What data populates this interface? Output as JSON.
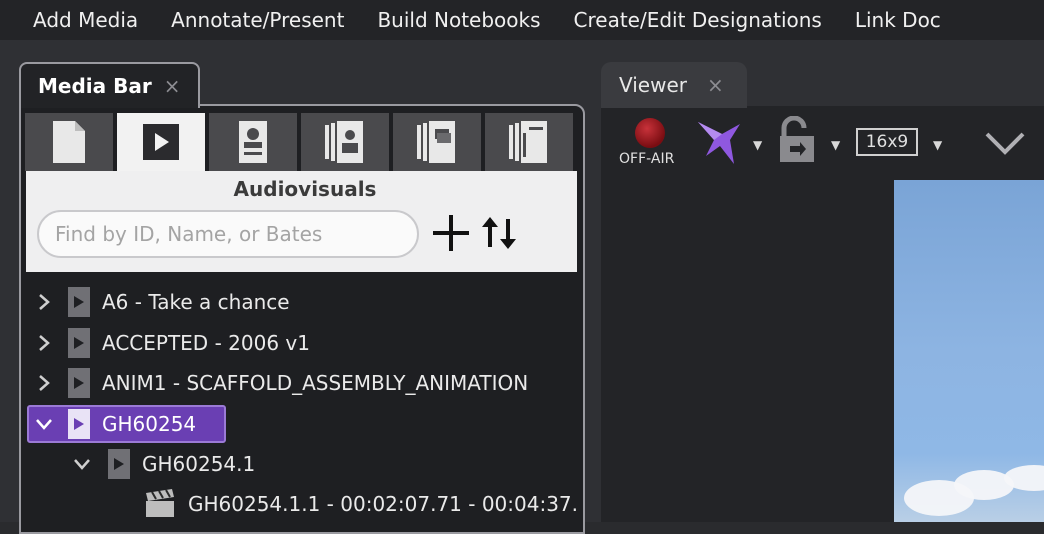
{
  "menu": [
    "Add Media",
    "Annotate/Present",
    "Build Notebooks",
    "Create/Edit Designations",
    "Link Doc"
  ],
  "media_bar": {
    "tab_title": "Media Bar",
    "close_glyph": "×",
    "type_tabs": [
      "document-icon",
      "audiovisual-icon",
      "deposition-icon",
      "exhibit-icon",
      "collection-icon",
      "notebook-icon"
    ],
    "active_type_tab": 1,
    "section_title": "Audiovisuals",
    "search_placeholder": "Find by ID, Name, or Bates",
    "tree": [
      {
        "label": "A6 - Take a chance",
        "expanded": false,
        "selected": false
      },
      {
        "label": "ACCEPTED - 2006 v1",
        "expanded": false,
        "selected": false
      },
      {
        "label": "ANIM1 - SCAFFOLD_ASSEMBLY_ANIMATION",
        "expanded": false,
        "selected": false
      },
      {
        "label": "GH60254",
        "expanded": true,
        "selected": true
      },
      {
        "label": "GH60254.1",
        "expanded": true,
        "selected": false
      },
      {
        "label": "GH60254.1.1 - 00:02:07.71 - 00:04:37.",
        "expanded": false,
        "selected": false
      }
    ]
  },
  "viewer": {
    "tab_title": "Viewer",
    "close_glyph": "×",
    "offair_label": "OFF-AIR",
    "aspect_ratio": "16x9",
    "colors": {
      "accent": "#6a3fb3",
      "offair": "#b3202a"
    }
  }
}
